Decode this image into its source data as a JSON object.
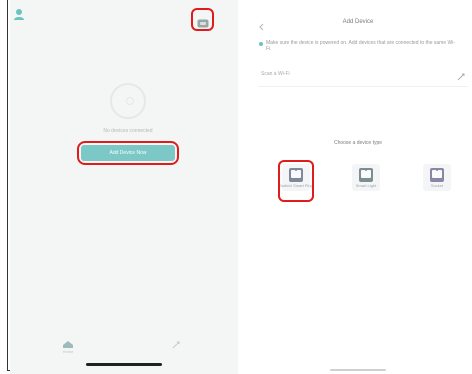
{
  "left_screen": {
    "empty_message": "No devices connected",
    "add_device_label": "Add Device Now",
    "tabs": [
      {
        "label": "Home",
        "icon": "home-icon"
      },
      {
        "label": "",
        "icon": "share-icon"
      }
    ]
  },
  "right_screen": {
    "title": "Add Device",
    "notice": "Make sure the device is powered on. Add devices that are connected to the same Wi-Fi.",
    "wifi_label": "Scan a Wi-Fi",
    "section_title": "Choose a device type",
    "devices": [
      {
        "label": "Switch/ Smart Plug"
      },
      {
        "label": "Smart Light"
      },
      {
        "label": "Socket"
      }
    ]
  },
  "colors": {
    "accent": "#7cc8c6",
    "highlight": "#e01b1b"
  }
}
